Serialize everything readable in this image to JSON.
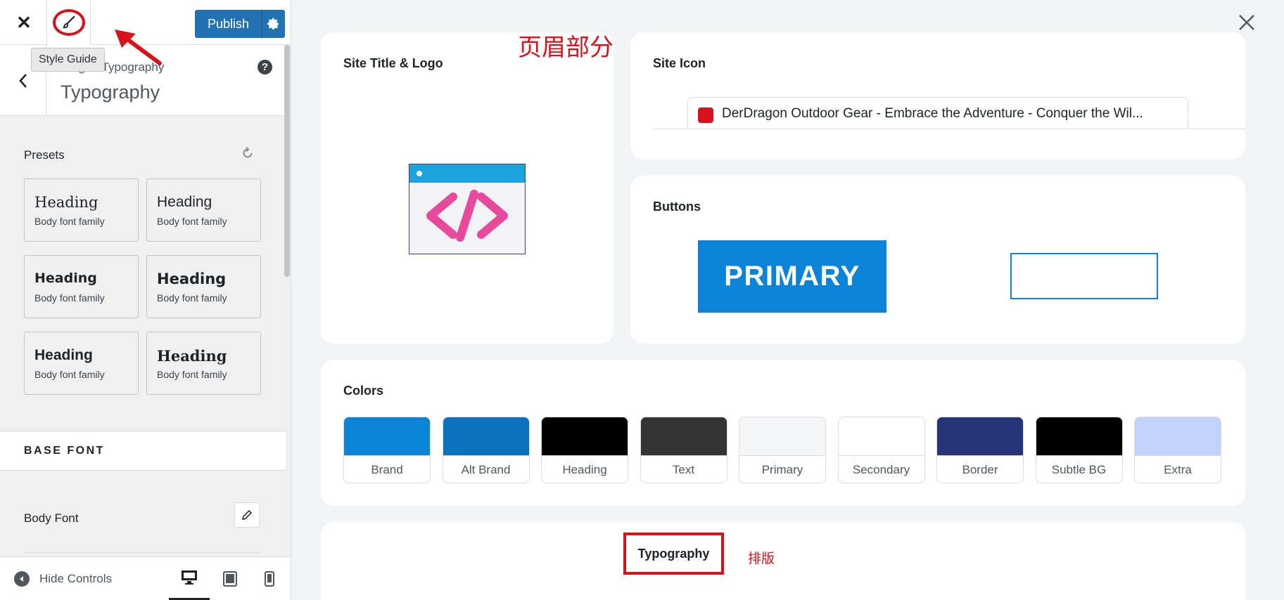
{
  "topbar": {
    "publish_label": "Publish",
    "tooltip": "Style Guide"
  },
  "section": {
    "breadcrumb_parent": "Customizing",
    "breadcrumb_visible_parent": "izing",
    "breadcrumb_arrow": "▸",
    "breadcrumb_current": "Typography",
    "title": "Typography",
    "help": "?"
  },
  "presets": {
    "label": "Presets",
    "items": [
      {
        "heading": "Heading",
        "body": "Body font family"
      },
      {
        "heading": "Heading",
        "body": "Body font family"
      },
      {
        "heading": "Heading",
        "body": "Body font family"
      },
      {
        "heading": "Heading",
        "body": "Body font family"
      },
      {
        "heading": "Heading",
        "body": "Body font family"
      },
      {
        "heading": "Heading",
        "body": "Body font family"
      }
    ]
  },
  "base_font": {
    "heading": "BASE FONT",
    "body_font_label": "Body Font"
  },
  "footer": {
    "hide_controls": "Hide Controls"
  },
  "preview": {
    "annotation_header": "页眉部分",
    "site_title_logo": "Site Title & Logo",
    "site_icon": "Site Icon",
    "site_icon_tab_text": "DerDragon Outdoor Gear - Embrace the Adventure - Conquer the Wil...",
    "buttons": "Buttons",
    "primary_button": "PRIMARY",
    "colors": "Colors",
    "swatches": [
      {
        "label": "Brand",
        "color": "#0b84d8"
      },
      {
        "label": "Alt Brand",
        "color": "#0a73bf"
      },
      {
        "label": "Heading",
        "color": "#000000"
      },
      {
        "label": "Text",
        "color": "#333333"
      },
      {
        "label": "Primary",
        "color": "#f4f5f7"
      },
      {
        "label": "Secondary",
        "color": "#ffffff"
      },
      {
        "label": "Border",
        "color": "#263575"
      },
      {
        "label": "Subtle BG",
        "color": "#000000"
      },
      {
        "label": "Extra",
        "color": "#c2d2fc"
      }
    ],
    "typography": "Typography",
    "annotation_typography": "排版"
  },
  "colors": {
    "accent": "#2271b1",
    "annotation_red": "#d6131c"
  }
}
